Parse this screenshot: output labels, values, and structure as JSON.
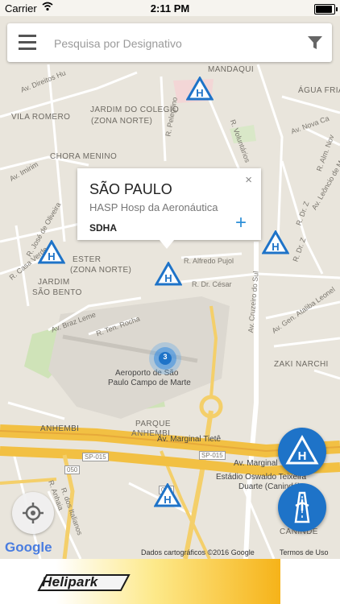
{
  "status_bar": {
    "carrier": "Carrier",
    "time": "2:11 PM",
    "battery_level": 1.0
  },
  "search": {
    "placeholder": "Pesquisa por Designativo"
  },
  "map_labels": {
    "neighborhoods": [
      "MANDAQUI",
      "JARDIM DO COLEGIO",
      "(ZONA NORTE)",
      "VILA ROMERO",
      "CHORA MENINO",
      "ÁGUA FRIA",
      "ESTER",
      "(ZONA NORTE)",
      "JARDIM",
      "SÃO BENTO",
      "ZAKI NARCHI",
      "PARQUE",
      "ANHEMBI",
      "ANHEMBI",
      "CANINDÉ"
    ],
    "streets": [
      "Av. Direitos Hu",
      "R. Pelegrino",
      "R. Voluntários",
      "Av. Imirim",
      "Av. Nova Ca",
      "R. Alm. Nov",
      "Av. Leôncio de M",
      "R. José de Oliveira",
      "R. Casa Verde",
      "R. Alfredo Pujol",
      "R. Dr. César",
      "Av. Braz Leme",
      "R. Ten. Rocha",
      "Av. Cruzeiro do Sul",
      "Av. Gen. Ataliba Leonel",
      "Aeroporto de São",
      "Paulo Campo de Marte",
      "Av. Marginal Tietê",
      "SP-015",
      "SP-015",
      "Av. Marginal",
      "050",
      "050",
      "Estádio Oswaldo Teixeira",
      "Duarte (Canindé)",
      "R. dos Italianos",
      "R. Anhaia",
      "R. Dr. Z",
      "R. Dr. Z"
    ]
  },
  "popup": {
    "title": "SÃO PAULO",
    "subtitle": "HASP Hosp da Aeronáutica",
    "code": "SDHA",
    "close_symbol": "×",
    "add_symbol": "+"
  },
  "cluster": {
    "count": "3"
  },
  "heliport_markers": [
    "heliport-icon",
    "heliport-icon",
    "heliport-icon",
    "heliport-icon",
    "heliport-icon"
  ],
  "floating_buttons": {
    "heliport_filter": "heliport-icon",
    "runway_filter": "runway-icon"
  },
  "footer": {
    "google": "Google",
    "attribution": "Dados cartográficos ©2016 Google",
    "terms": "Termos de Uso"
  },
  "ad": {
    "brand": "Helipark"
  },
  "colors": {
    "marker_blue": "#1e73c8",
    "popup_plus": "#2d8fd8",
    "highway": "#f2c043",
    "ad_yellow": "#f6b319"
  }
}
